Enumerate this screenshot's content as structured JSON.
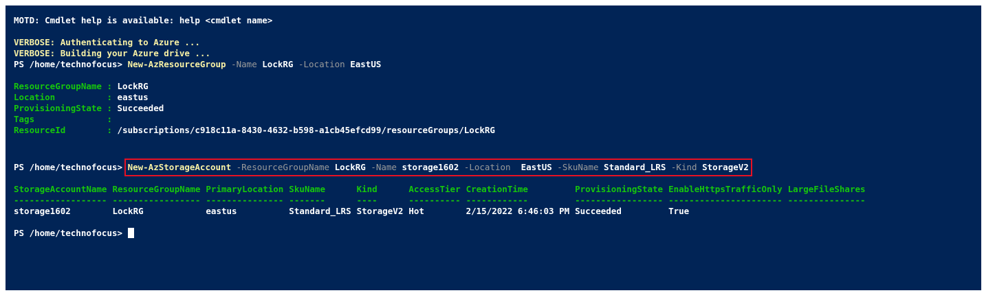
{
  "motd": "MOTD: Cmdlet help is available: help <cmdlet name>",
  "verbose": [
    "VERBOSE: Authenticating to Azure ...",
    "VERBOSE: Building your Azure drive ..."
  ],
  "prompt": "PS /home/technofocus>",
  "cmd1": {
    "name": "New-AzResourceGroup",
    "p1": "-Name",
    "v1": "LockRG",
    "p2": "-Location",
    "v2": "EastUS"
  },
  "rg": [
    {
      "key": "ResourceGroupName",
      "value": "LockRG"
    },
    {
      "key": "Location",
      "value": "eastus"
    },
    {
      "key": "ProvisioningState",
      "value": "Succeeded"
    },
    {
      "key": "Tags",
      "value": ""
    },
    {
      "key": "ResourceId",
      "value": "/subscriptions/c918c11a-8430-4632-b598-a1cb45efcd99/resourceGroups/LockRG"
    }
  ],
  "cmd2": {
    "name": "New-AzStorageAccount",
    "p1": "-ResourceGroupName",
    "v1": "LockRG",
    "p2": "-Name",
    "v2": "storage1602",
    "p3": "-Location",
    "v3": "EastUS",
    "p4": "-SkuName",
    "v4": "Standard_LRS",
    "p5": "-Kind",
    "v5": "StorageV2"
  },
  "storage": {
    "headers": [
      "StorageAccountName",
      "ResourceGroupName",
      "PrimaryLocation",
      "SkuName",
      "Kind",
      "AccessTier",
      "CreationTime",
      "ProvisioningState",
      "EnableHttpsTrafficOnly",
      "LargeFileShares"
    ],
    "dashes": [
      "------------------",
      "-----------------",
      "---------------",
      "-------",
      "----",
      "----------",
      "------------",
      "-----------------",
      "----------------------",
      "---------------"
    ],
    "row": [
      "storage1602",
      "LockRG",
      "eastus",
      "Standard_LRS",
      "StorageV2",
      "Hot",
      "2/15/2022 6:46:03 PM",
      "Succeeded",
      "True",
      ""
    ]
  },
  "colors": {
    "background": "#012456",
    "command": "#f9f1a5",
    "parameter": "#9a9a9a",
    "property": "#16c60c",
    "highlight_box": "#e81123"
  }
}
